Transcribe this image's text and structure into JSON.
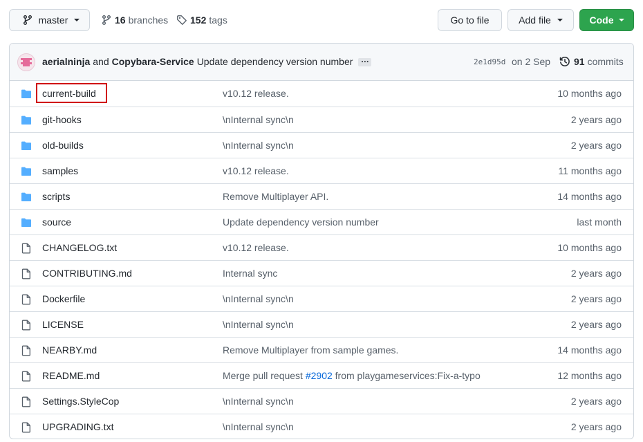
{
  "toolbar": {
    "branch": "master",
    "branches_count": "16",
    "branches_label": "branches",
    "tags_count": "152",
    "tags_label": "tags",
    "go_to_file": "Go to file",
    "add_file": "Add file",
    "code": "Code"
  },
  "commit": {
    "author1": "aerialninja",
    "and": "and",
    "author2": "Copybara-Service",
    "message": "Update dependency version number",
    "ellipsis": "…",
    "sha": "2e1d95d",
    "date": "on 2 Sep",
    "commits_count": "91",
    "commits_label": "commits"
  },
  "files": [
    {
      "type": "dir",
      "name": "current-build",
      "message": "v10.12 release.",
      "age": "10 months ago",
      "highlighted": true
    },
    {
      "type": "dir",
      "name": "git-hooks",
      "message": "\\nInternal sync\\n",
      "age": "2 years ago"
    },
    {
      "type": "dir",
      "name": "old-builds",
      "message": "\\nInternal sync\\n",
      "age": "2 years ago"
    },
    {
      "type": "dir",
      "name": "samples",
      "message": "v10.12 release.",
      "age": "11 months ago"
    },
    {
      "type": "dir",
      "name": "scripts",
      "message": "Remove Multiplayer API.",
      "age": "14 months ago"
    },
    {
      "type": "dir",
      "name": "source",
      "message": "Update dependency version number",
      "age": "last month"
    },
    {
      "type": "file",
      "name": "CHANGELOG.txt",
      "message": "v10.12 release.",
      "age": "10 months ago"
    },
    {
      "type": "file",
      "name": "CONTRIBUTING.md",
      "message": "Internal sync",
      "age": "2 years ago"
    },
    {
      "type": "file",
      "name": "Dockerfile",
      "message": "\\nInternal sync\\n",
      "age": "2 years ago"
    },
    {
      "type": "file",
      "name": "LICENSE",
      "message": "\\nInternal sync\\n",
      "age": "2 years ago"
    },
    {
      "type": "file",
      "name": "NEARBY.md",
      "message": "Remove Multiplayer from sample games.",
      "age": "14 months ago"
    },
    {
      "type": "file",
      "name": "README.md",
      "message_pre": "Merge pull request ",
      "message_link": "#2902",
      "message_post": " from playgameservices:Fix-a-typo",
      "age": "12 months ago"
    },
    {
      "type": "file",
      "name": "Settings.StyleCop",
      "message": "\\nInternal sync\\n",
      "age": "2 years ago"
    },
    {
      "type": "file",
      "name": "UPGRADING.txt",
      "message": "\\nInternal sync\\n",
      "age": "2 years ago"
    }
  ],
  "colors": {
    "folder": "#54aeff",
    "file": "#57606a",
    "code_button": "#2da44e",
    "link": "#0969da",
    "highlight": "#d0000c"
  }
}
